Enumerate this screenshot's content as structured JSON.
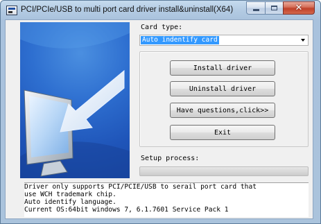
{
  "window": {
    "title": "PCI/PCIe/USB to multi port card driver install&uninstall(X64)",
    "icon": "app-icon",
    "controls": {
      "minimize_icon": "minimize-icon",
      "maximize_icon": "maximize-icon",
      "close_icon": "close-icon",
      "close_glyph": "✕"
    }
  },
  "card_type": {
    "label": "Card type:",
    "selected": "Auto indentify card"
  },
  "buttons": {
    "install": "Install driver",
    "uninstall": "Uninstall driver",
    "questions": "Have questions,click>>",
    "exit": "Exit"
  },
  "setup": {
    "label": "Setup process:",
    "progress_fraction": 0
  },
  "info": {
    "lines": [
      "Driver only supports PCI/PCIE/USB to serail port card that",
      "use WCH trademark chip.",
      "Auto identify language.",
      "Current OS:64bit windows 7, 6.1.7601 Service Pack 1"
    ]
  },
  "colors": {
    "selection": "#3399ff",
    "hero_blue": "#2e6fd0",
    "close_red": "#c0412a"
  }
}
